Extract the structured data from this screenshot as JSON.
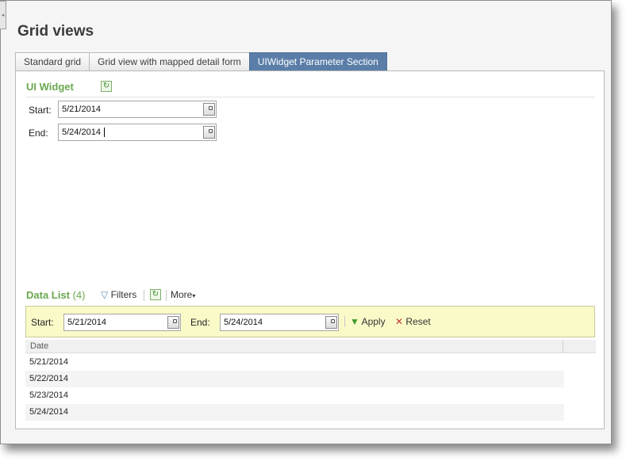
{
  "page": {
    "title": "Grid views"
  },
  "tabs": [
    {
      "label": "Standard grid",
      "active": false
    },
    {
      "label": "Grid view with mapped detail form",
      "active": false
    },
    {
      "label": "UIWidget Parameter Section",
      "active": true
    }
  ],
  "ui_widget": {
    "title": "UI Widget",
    "refresh_icon": "refresh-icon",
    "start_label": "Start:",
    "start_value": "5/21/2014",
    "end_label": "End:",
    "end_value": "5/24/2014"
  },
  "data_list": {
    "title": "Data List",
    "count": "(4)",
    "filters_label": "Filters",
    "more_label": "More",
    "filter_bar": {
      "start_label": "Start:",
      "start_value": "5/21/2014",
      "end_label": "End:",
      "end_value": "5/24/2014",
      "apply_label": "Apply",
      "reset_label": "Reset"
    },
    "columns": [
      "Date"
    ],
    "rows": [
      "5/21/2014",
      "5/22/2014",
      "5/23/2014",
      "5/24/2014"
    ]
  },
  "colors": {
    "accent_green": "#6aa84f",
    "active_tab": "#5a7ea8",
    "filter_bar_bg": "#fafac9"
  }
}
